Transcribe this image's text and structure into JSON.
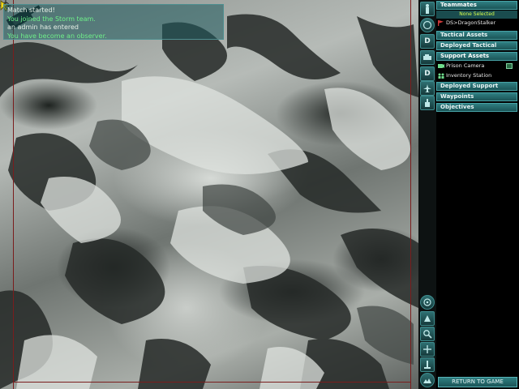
{
  "chat": {
    "lines": [
      {
        "text": "Match started!",
        "color": "#e6efe6"
      },
      {
        "text": "You joined the Storm team.",
        "color": "#6ef08a"
      },
      {
        "text": "an admin has entered",
        "color": "#e6efe6"
      },
      {
        "text": "You have become an observer.",
        "color": "#6ef08a"
      }
    ]
  },
  "panel": {
    "teammates_label": "Teammates",
    "none_selected": "None Selected",
    "teammate_name": "DS>DragonStalker",
    "tactical_assets": "Tactical Assets",
    "deployed_tactical": "Deployed Tactical",
    "support_assets": "Support Assets",
    "prison_camera": "Prison Camera",
    "inventory_station": "Inventory Station",
    "deployed_support": "Deployed Support",
    "waypoints": "Waypoints",
    "objectives": "Objectives",
    "return_button": "RETURN TO GAME"
  },
  "icon_column": {
    "top_icons": [
      "soldier-icon",
      "circle-target-icon",
      "d-icon",
      "vehicle-icon",
      "d-icon",
      "jet-icon",
      "turret-icon"
    ],
    "d_letter": "D",
    "bottom_icons": [
      "center-icon",
      "pan-icon",
      "zoom-icon",
      "move-icon",
      "sensor-icon",
      "terrain-icon"
    ]
  },
  "colors": {
    "accent": "#2f7f82",
    "panel_header_border": "#48a3a6",
    "highlight_yellow": "#d7ff4a",
    "chat_green": "#6ef08a"
  }
}
